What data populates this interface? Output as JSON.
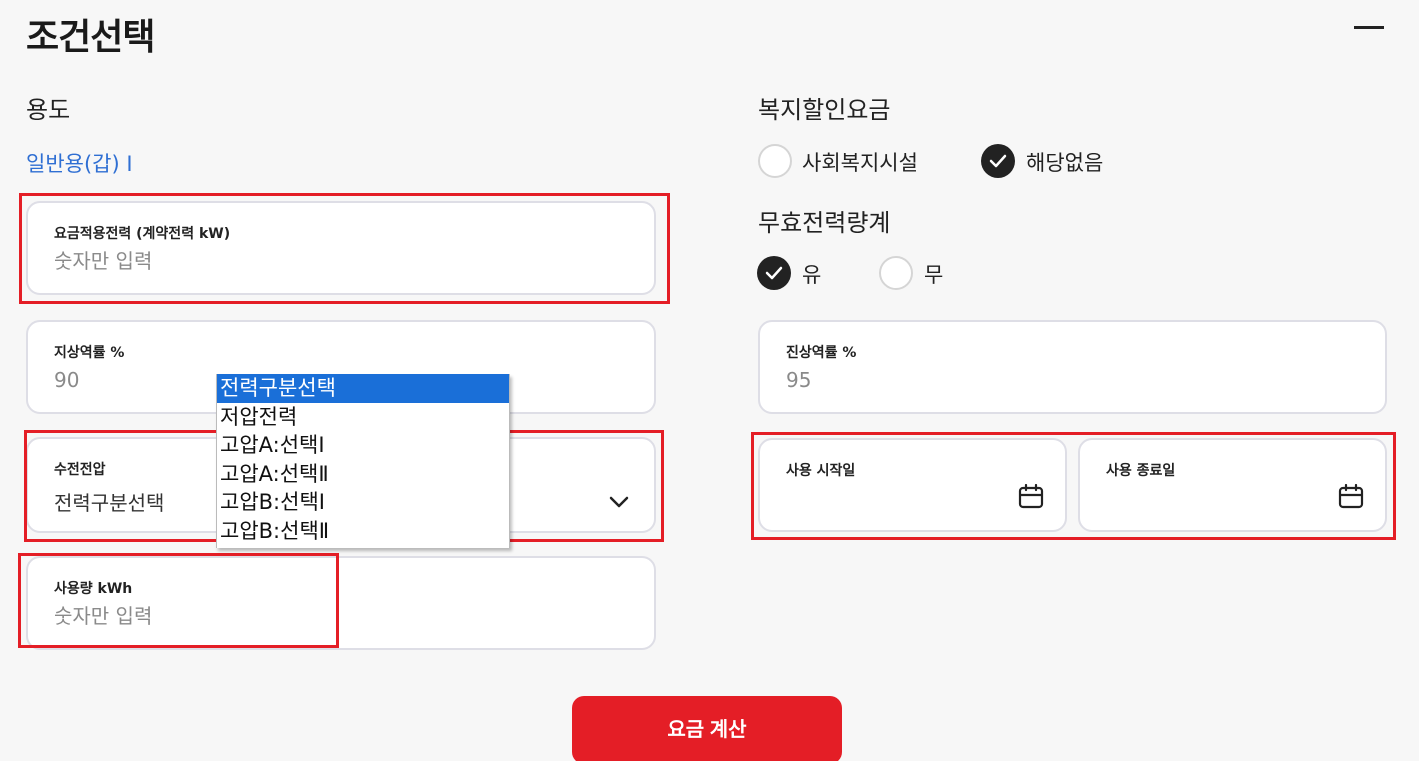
{
  "header": {
    "title": "조건선택"
  },
  "left": {
    "usage_label": "용도",
    "usage_value": "일반용(갑) Ⅰ",
    "contract_power": {
      "label": "요금적용전력 (계약전력 kW)",
      "placeholder": "숫자만 입력"
    },
    "lagging_pf": {
      "label": "지상역률 %",
      "placeholder": "90"
    },
    "voltage": {
      "label": "수전전압",
      "selected": "전력구분선택"
    },
    "usage_kwh": {
      "label": "사용량 kWh",
      "placeholder": "숫자만 입력"
    }
  },
  "right": {
    "welfare_label": "복지할인요금",
    "welfare_options": [
      {
        "label": "사회복지시설",
        "checked": false
      },
      {
        "label": "해당없음",
        "checked": true
      }
    ],
    "reactive_label": "무효전력량계",
    "reactive_options": [
      {
        "label": "유",
        "checked": true
      },
      {
        "label": "무",
        "checked": false
      }
    ],
    "leading_pf": {
      "label": "진상역률 %",
      "placeholder": "95"
    },
    "start_date": {
      "label": "사용 시작일"
    },
    "end_date": {
      "label": "사용 종료일"
    }
  },
  "dropdown": {
    "options": [
      "전력구분선택",
      "저압전력",
      "고압A:선택Ⅰ",
      "고압A:선택Ⅱ",
      "고압B:선택Ⅰ",
      "고압B:선택Ⅱ"
    ],
    "selected_index": 0
  },
  "actions": {
    "calculate_label": "요금 계산"
  },
  "colors": {
    "accent": "#e41e26",
    "link": "#2f6fd3",
    "selected_option": "#1a6fd8",
    "checked_radio": "#222222"
  }
}
